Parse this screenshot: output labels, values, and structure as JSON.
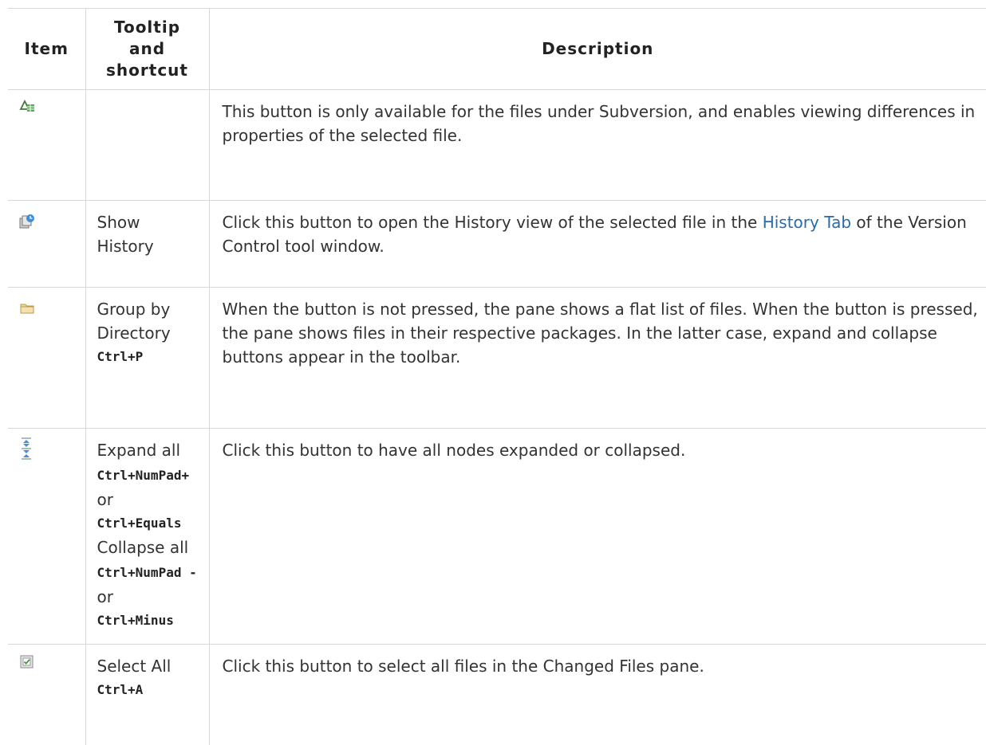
{
  "headers": {
    "item": "Item",
    "tooltip": "Tooltip and shortcut",
    "description": "Description"
  },
  "rows": [
    {
      "icon": "properties-diff-icon",
      "description": "This button is only available for the files under Subversion, and enables viewing differences in properties of the selected file."
    },
    {
      "icon": "show-history-icon",
      "tooltip": "Show History",
      "description_before": "Click this button to open the History view of the selected file in the ",
      "link": "History Tab",
      "description_after": " of the Version Control tool window."
    },
    {
      "icon": "folder-icon",
      "tooltip": "Group by Directory",
      "shortcut": "Ctrl+P",
      "description": "When the button is not pressed, the pane shows a flat list of files. When the button is pressed, the pane shows files in their respective packages. In the latter case, expand and collapse buttons appear in the toolbar."
    },
    {
      "icon": "expand-collapse-icon",
      "tooltip": "Expand all",
      "shortcut1": "Ctrl+NumPad+",
      "or1": "or",
      "shortcut2": "Ctrl+Equals",
      "tooltip2": "Collapse all",
      "shortcut3": "Ctrl+NumPad -",
      "or2": "or",
      "shortcut4": "Ctrl+Minus",
      "description": "Click this button to have all nodes expanded or collapsed."
    },
    {
      "icon": "select-all-icon",
      "tooltip": "Select All",
      "shortcut": "Ctrl+A",
      "description": "Click this button to select all files in the Changed Files pane."
    }
  ]
}
